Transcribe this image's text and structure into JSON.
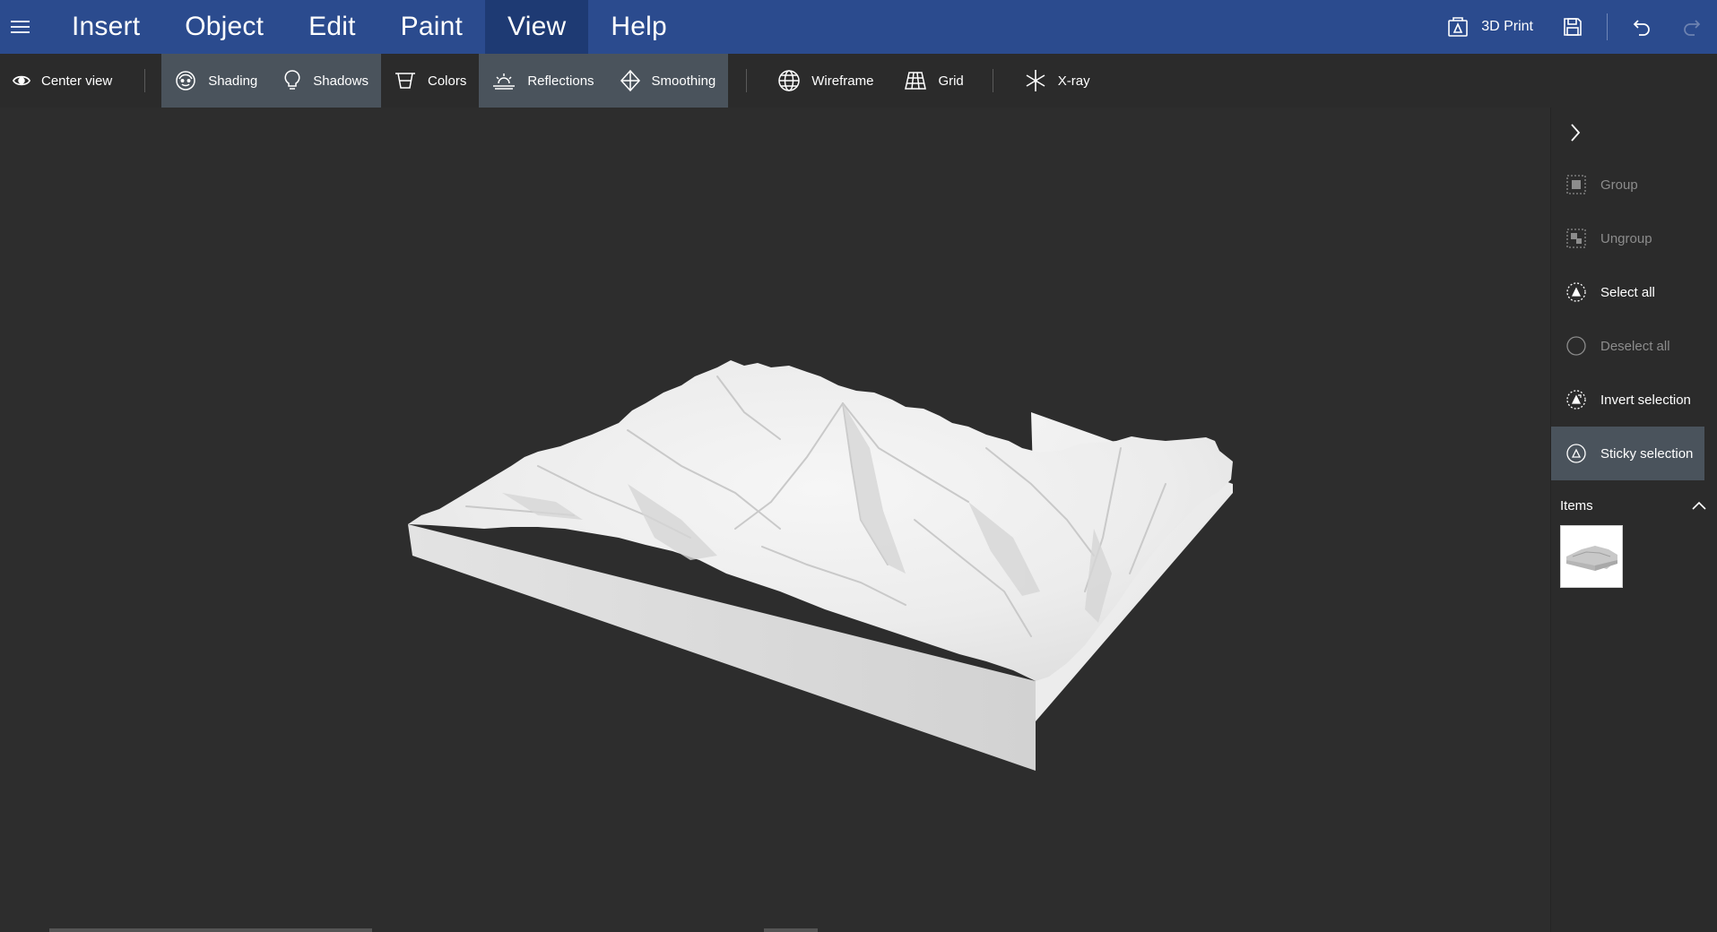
{
  "menubar": {
    "tabs": [
      {
        "label": "Insert"
      },
      {
        "label": "Object"
      },
      {
        "label": "Edit"
      },
      {
        "label": "Paint"
      },
      {
        "label": "View",
        "active": true
      },
      {
        "label": "Help"
      }
    ],
    "print_label": "3D Print",
    "icons": [
      "hamburger-icon",
      "3d-print-icon",
      "save-icon",
      "undo-icon",
      "redo-icon"
    ]
  },
  "toolbar": {
    "center_view": "Center view",
    "shading": "Shading",
    "shadows": "Shadows",
    "colors": "Colors",
    "reflections": "Reflections",
    "smoothing": "Smoothing",
    "wireframe": "Wireframe",
    "grid": "Grid",
    "xray": "X-ray",
    "active_tools": [
      "Shading",
      "Shadows",
      "Reflections",
      "Smoothing"
    ]
  },
  "panel": {
    "actions": [
      {
        "label": "Group",
        "enabled": false
      },
      {
        "label": "Ungroup",
        "enabled": false
      },
      {
        "label": "Select all",
        "enabled": true
      },
      {
        "label": "Deselect all",
        "enabled": false
      },
      {
        "label": "Invert selection",
        "enabled": true
      },
      {
        "label": "Sticky selection",
        "enabled": true,
        "active": true
      }
    ],
    "items_label": "Items"
  },
  "colors": {
    "menubar": "#2b4b8e",
    "menubar_active": "#1e3a73",
    "toolbar": "#2b2b2b",
    "toggle_on": "#4a535c",
    "viewport": "#2d2d2d",
    "model": "#e8e8e8"
  }
}
